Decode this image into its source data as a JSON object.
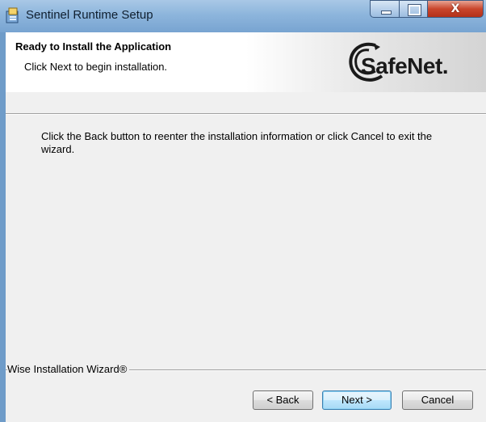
{
  "window": {
    "title": "Sentinel Runtime Setup",
    "close_glyph": "X"
  },
  "header": {
    "title": "Ready to Install the Application",
    "subtitle": "Click Next to begin installation.",
    "logo_text": "SafeNet."
  },
  "body": {
    "text": "Click the Back button to reenter the installation information or click Cancel to exit the wizard."
  },
  "branding": {
    "text": "Wise Installation Wizard®"
  },
  "buttons": {
    "back": "< Back",
    "next": "Next >",
    "cancel": "Cancel"
  },
  "colors": {
    "titlebar": "#8db5dc",
    "close_button": "#c9462c",
    "dialog_background": "#f0f0f0",
    "default_button_border": "#3c7fb1"
  },
  "icons": {
    "app": "setup-package-icon",
    "minimize": "minimize-icon",
    "maximize": "maximize-icon",
    "close": "close-icon"
  }
}
